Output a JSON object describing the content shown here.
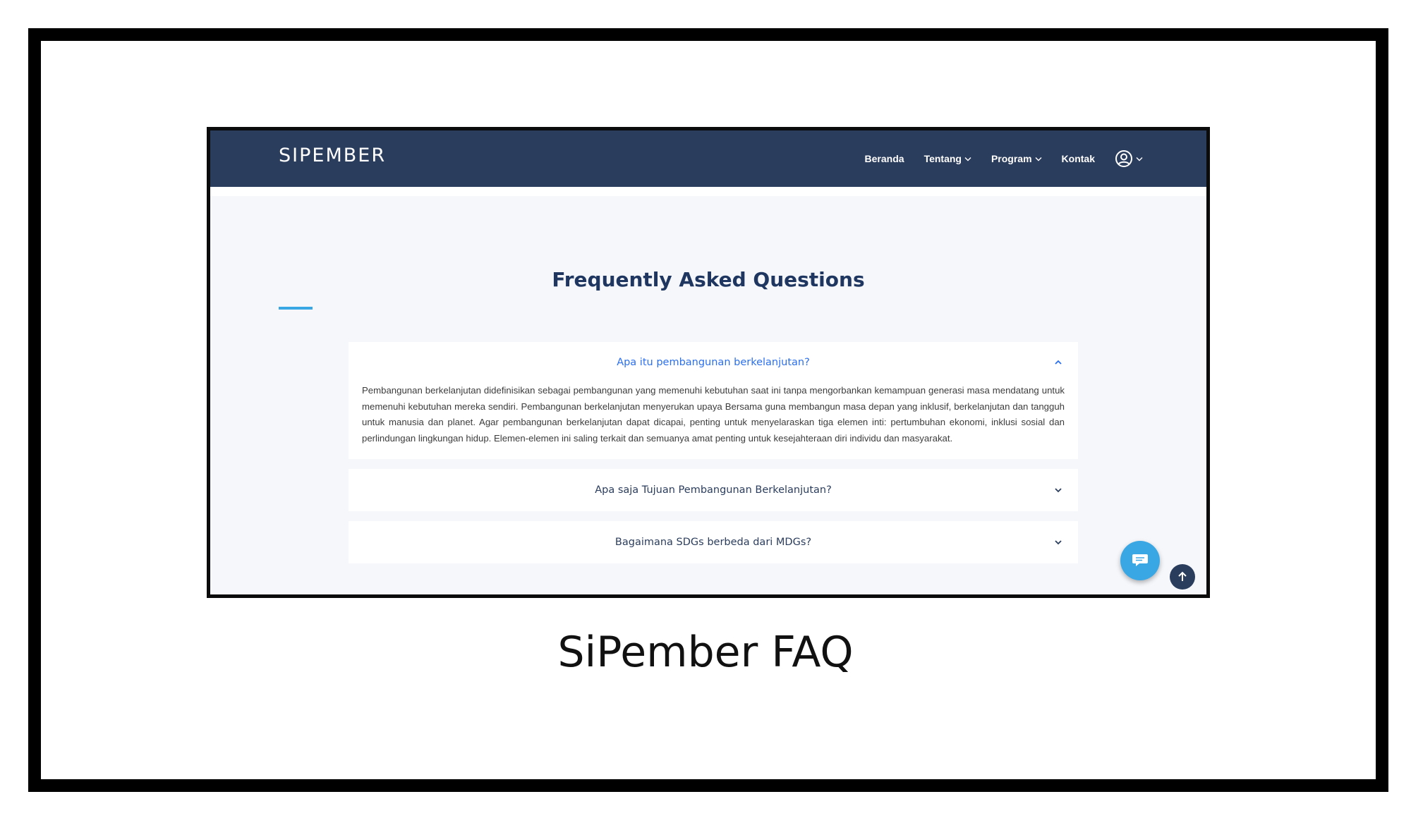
{
  "header": {
    "logo": "SIPEMBER",
    "nav": [
      {
        "label": "Beranda",
        "has_dropdown": false
      },
      {
        "label": "Tentang",
        "has_dropdown": true
      },
      {
        "label": "Program",
        "has_dropdown": true
      },
      {
        "label": "Kontak",
        "has_dropdown": false
      }
    ],
    "user_icon": "user-circle-icon"
  },
  "main": {
    "title": "Frequently Asked Questions",
    "faq": [
      {
        "question": "Apa itu pembangunan berkelanjutan?",
        "expanded": true,
        "answer": "Pembangunan berkelanjutan didefinisikan sebagai pembangunan yang memenuhi kebutuhan saat ini tanpa mengorbankan kemampuan generasi masa mendatang untuk memenuhi kebutuhan mereka sendiri. Pembangunan berkelanjutan menyerukan upaya Bersama guna membangun masa depan yang inklusif, berkelanjutan dan tangguh untuk manusia dan planet. Agar pembangunan berkelanjutan dapat dicapai, penting untuk menyelaraskan tiga elemen inti: pertumbuhan ekonomi, inklusi sosial dan perlindungan lingkungan hidup. Elemen-elemen ini saling terkait dan semuanya amat penting untuk kesejahteraan diri individu dan masyarakat."
      },
      {
        "question": "Apa saja Tujuan Pembangunan Berkelanjutan?",
        "expanded": false
      },
      {
        "question": "Bagaimana SDGs berbeda dari MDGs?",
        "expanded": false
      }
    ]
  },
  "floating": {
    "chat_icon": "chat-bubble-icon",
    "scroll_top_icon": "arrow-up-icon"
  },
  "caption": "SiPember FAQ",
  "colors": {
    "navbar": "#2b3d5d",
    "title": "#1f3760",
    "accent": "#3aa7e5",
    "active_question": "#2a6ff0"
  }
}
